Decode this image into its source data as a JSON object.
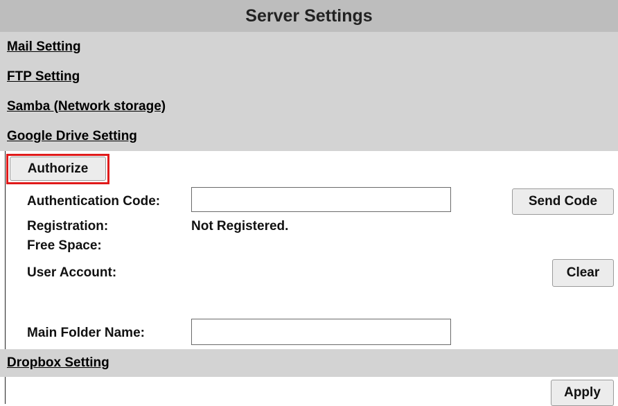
{
  "header": {
    "title": "Server Settings"
  },
  "sections": {
    "mail": "Mail Setting",
    "ftp": "FTP Setting",
    "samba": "Samba (Network storage)",
    "google_drive": "Google Drive Setting",
    "dropbox": "Dropbox Setting"
  },
  "google_drive": {
    "authorize_label": "Authorize",
    "auth_code_label": "Authentication Code:",
    "auth_code_value": "",
    "send_code_label": "Send Code",
    "registration_label": "Registration:",
    "registration_value": "Not Registered.",
    "free_space_label": "Free Space:",
    "user_account_label": "User Account:",
    "clear_label": "Clear",
    "main_folder_label": "Main Folder Name:",
    "main_folder_value": ""
  },
  "footer": {
    "apply_label": "Apply"
  },
  "colors": {
    "highlight": "#e01a1a",
    "section_bg": "#d3d3d3",
    "title_bg": "#bdbdbd"
  }
}
